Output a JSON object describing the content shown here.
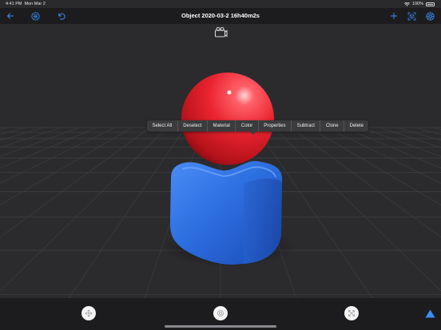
{
  "status_bar": {
    "time": "4:41 PM",
    "date": "Mon Mar 2",
    "battery": "100%",
    "wifi_icon": "wifi-icon"
  },
  "nav": {
    "title": "Object 2020-03-2 16h40m2s",
    "left_icons": [
      "back-arrow-icon",
      "list-icon",
      "undo-icon"
    ],
    "right_icons": [
      "add-icon",
      "scan-icon",
      "settings-icon"
    ]
  },
  "camera_icon": "camera-icon",
  "context_menu": {
    "items": [
      "Select All",
      "Deselect",
      "Material",
      "Color",
      "Properties",
      "Subtract",
      "Clone",
      "Delete"
    ]
  },
  "toolbar": {
    "buttons": [
      "move-icon",
      "rotate-icon",
      "scale-icon"
    ],
    "expand_icon": "triangle-up-icon"
  },
  "colors": {
    "accent": "#3a8ef6",
    "sphere": "#e8222e",
    "cube": "#2f6fe0",
    "background": "#2b2b2d"
  }
}
